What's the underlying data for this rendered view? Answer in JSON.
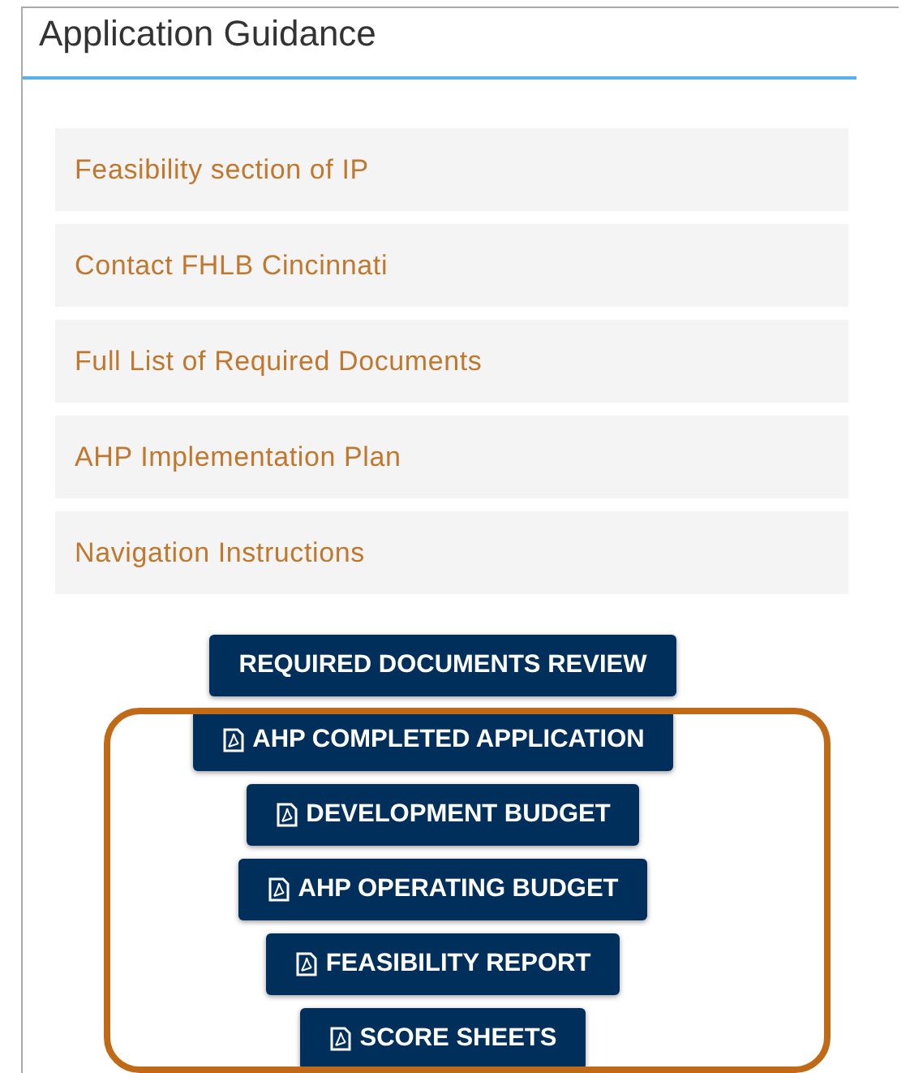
{
  "panel": {
    "title": "Application Guidance"
  },
  "links": [
    "Feasibility section of IP",
    "Contact FHLB Cincinnati",
    "Full List of Required Documents",
    "AHP Implementation Plan",
    "Navigation Instructions"
  ],
  "buttons": [
    {
      "label": "REQUIRED DOCUMENTS REVIEW",
      "kind": "plain"
    },
    {
      "label": "AHP COMPLETED APPLICATION",
      "kind": "pdf"
    },
    {
      "label": "DEVELOPMENT BUDGET",
      "kind": "pdf"
    },
    {
      "label": "AHP OPERATING BUDGET",
      "kind": "pdf"
    },
    {
      "label": "FEASIBILITY REPORT",
      "kind": "pdf"
    },
    {
      "label": "SCORE SHEETS",
      "kind": "pdf"
    }
  ]
}
